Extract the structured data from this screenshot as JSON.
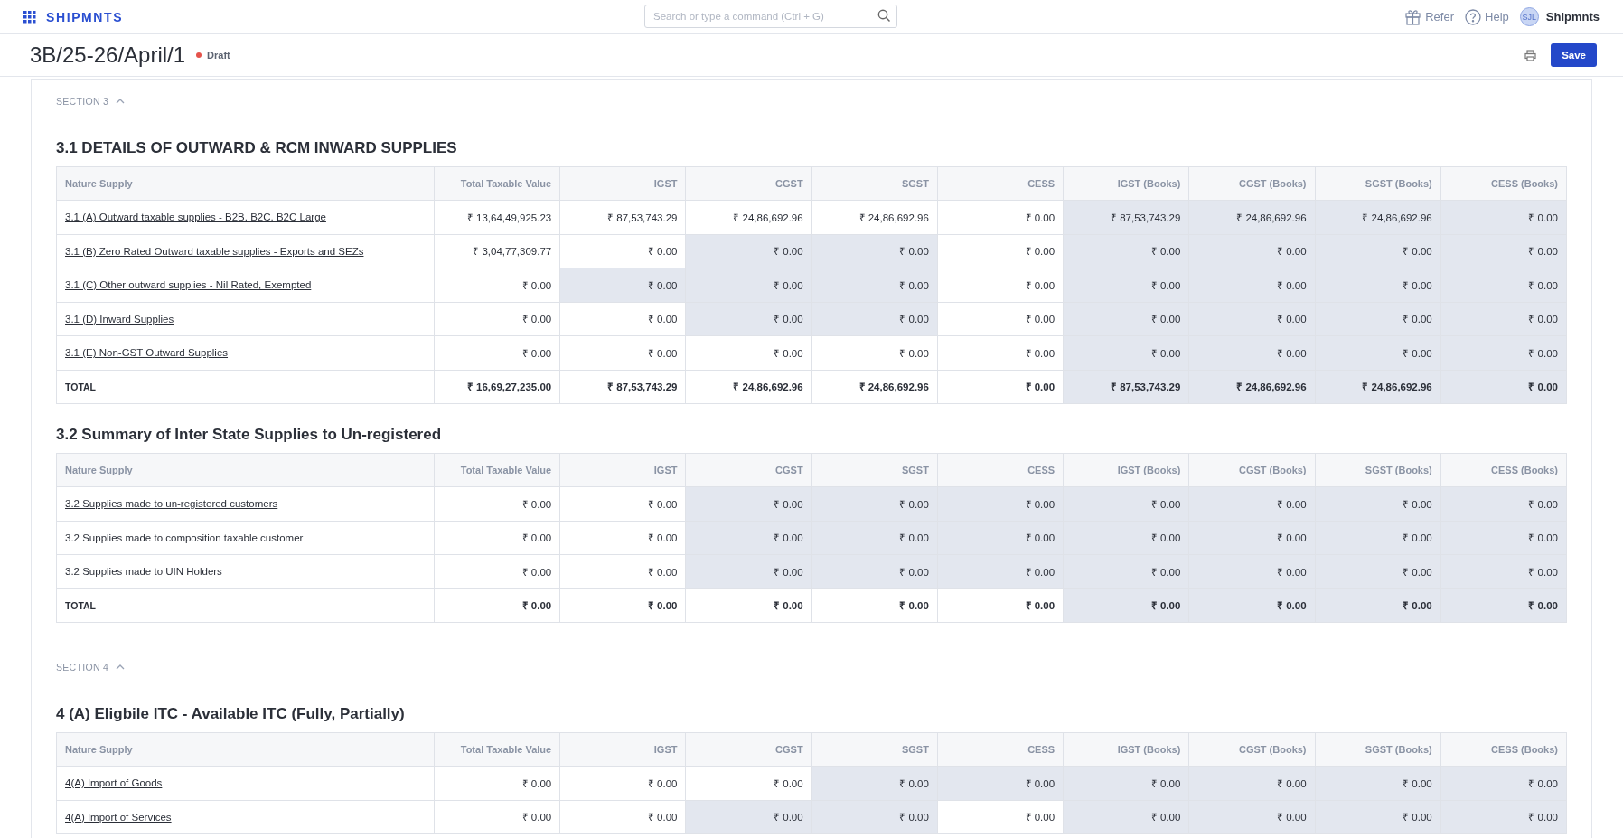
{
  "topbar": {
    "brand": "SHIPMNTS",
    "search": {
      "placeholder": "Search or type a command (Ctrl + G)"
    },
    "refer": "Refer",
    "help": "Help",
    "avatar": "SJL",
    "user": "Shipmnts"
  },
  "header": {
    "title": "3B/25-26/April/1",
    "status": "Draft",
    "save": "Save"
  },
  "sections": [
    {
      "label": "SECTION 3",
      "expanded": true,
      "tables": [
        {
          "title": "3.1 DETAILS OF OUTWARD & RCM INWARD SUPPLIES",
          "columns": [
            "Nature Supply",
            "Total Taxable Value",
            "IGST",
            "CGST",
            "SGST",
            "CESS",
            "IGST (Books)",
            "CGST (Books)",
            "SGST (Books)",
            "CESS (Books)"
          ],
          "rows": [
            {
              "kind": "link",
              "cells": [
                "3.1 (A) Outward taxable supplies - B2B, B2C, B2C Large",
                "₹ 13,64,49,925.23",
                "₹ 87,53,743.29",
                "₹ 24,86,692.96",
                "₹ 24,86,692.96",
                "₹ 0.00",
                "₹ 87,53,743.29",
                "₹ 24,86,692.96",
                "₹ 24,86,692.96",
                "₹ 0.00"
              ],
              "shaded": [
                false,
                false,
                false,
                false,
                false,
                false,
                true,
                true,
                true,
                true
              ]
            },
            {
              "kind": "link",
              "cells": [
                "3.1 (B) Zero Rated Outward taxable supplies - Exports and SEZs",
                "₹ 3,04,77,309.77",
                "₹ 0.00",
                "₹ 0.00",
                "₹ 0.00",
                "₹ 0.00",
                "₹ 0.00",
                "₹ 0.00",
                "₹ 0.00",
                "₹ 0.00"
              ],
              "shaded": [
                false,
                false,
                false,
                true,
                true,
                false,
                true,
                true,
                true,
                true
              ]
            },
            {
              "kind": "link",
              "cells": [
                "3.1 (C) Other outward supplies - Nil Rated, Exempted",
                "₹ 0.00",
                "₹ 0.00",
                "₹ 0.00",
                "₹ 0.00",
                "₹ 0.00",
                "₹ 0.00",
                "₹ 0.00",
                "₹ 0.00",
                "₹ 0.00"
              ],
              "shaded": [
                false,
                false,
                true,
                true,
                true,
                false,
                true,
                true,
                true,
                true
              ]
            },
            {
              "kind": "link",
              "cells": [
                "3.1 (D) Inward Supplies",
                "₹ 0.00",
                "₹ 0.00",
                "₹ 0.00",
                "₹ 0.00",
                "₹ 0.00",
                "₹ 0.00",
                "₹ 0.00",
                "₹ 0.00",
                "₹ 0.00"
              ],
              "shaded": [
                false,
                false,
                false,
                true,
                true,
                false,
                true,
                true,
                true,
                true
              ]
            },
            {
              "kind": "link",
              "cells": [
                "3.1 (E) Non-GST Outward Supplies",
                "₹ 0.00",
                "₹ 0.00",
                "₹ 0.00",
                "₹ 0.00",
                "₹ 0.00",
                "₹ 0.00",
                "₹ 0.00",
                "₹ 0.00",
                "₹ 0.00"
              ],
              "shaded": [
                false,
                false,
                false,
                false,
                false,
                false,
                true,
                true,
                true,
                true
              ]
            },
            {
              "kind": "total",
              "cells": [
                "TOTAL",
                "₹ 16,69,27,235.00",
                "₹ 87,53,743.29",
                "₹ 24,86,692.96",
                "₹ 24,86,692.96",
                "₹ 0.00",
                "₹ 87,53,743.29",
                "₹ 24,86,692.96",
                "₹ 24,86,692.96",
                "₹ 0.00"
              ],
              "shaded": [
                false,
                false,
                false,
                false,
                false,
                false,
                true,
                true,
                true,
                true
              ]
            }
          ]
        },
        {
          "title": "3.2 Summary of Inter State Supplies to Un-registered",
          "columns": [
            "Nature Supply",
            "Total Taxable Value",
            "IGST",
            "CGST",
            "SGST",
            "CESS",
            "IGST (Books)",
            "CGST (Books)",
            "SGST (Books)",
            "CESS (Books)"
          ],
          "rows": [
            {
              "kind": "link",
              "cells": [
                "3.2 Supplies made to un-registered customers",
                "₹ 0.00",
                "₹ 0.00",
                "₹ 0.00",
                "₹ 0.00",
                "₹ 0.00",
                "₹ 0.00",
                "₹ 0.00",
                "₹ 0.00",
                "₹ 0.00"
              ],
              "shaded": [
                false,
                false,
                false,
                true,
                true,
                true,
                true,
                true,
                true,
                true
              ]
            },
            {
              "kind": "plain",
              "cells": [
                "3.2 Supplies made to composition taxable customer",
                "₹ 0.00",
                "₹ 0.00",
                "₹ 0.00",
                "₹ 0.00",
                "₹ 0.00",
                "₹ 0.00",
                "₹ 0.00",
                "₹ 0.00",
                "₹ 0.00"
              ],
              "shaded": [
                false,
                false,
                false,
                true,
                true,
                true,
                true,
                true,
                true,
                true
              ]
            },
            {
              "kind": "plain",
              "cells": [
                "3.2 Supplies made to UIN Holders",
                "₹ 0.00",
                "₹ 0.00",
                "₹ 0.00",
                "₹ 0.00",
                "₹ 0.00",
                "₹ 0.00",
                "₹ 0.00",
                "₹ 0.00",
                "₹ 0.00"
              ],
              "shaded": [
                false,
                false,
                false,
                true,
                true,
                true,
                true,
                true,
                true,
                true
              ]
            },
            {
              "kind": "total",
              "cells": [
                "TOTAL",
                "₹ 0.00",
                "₹ 0.00",
                "₹ 0.00",
                "₹ 0.00",
                "₹ 0.00",
                "₹ 0.00",
                "₹ 0.00",
                "₹ 0.00",
                "₹ 0.00"
              ],
              "shaded": [
                false,
                false,
                false,
                false,
                false,
                false,
                true,
                true,
                true,
                true
              ]
            }
          ]
        }
      ]
    },
    {
      "label": "SECTION 4",
      "expanded": true,
      "tables": [
        {
          "title": "4 (A) Eligbile ITC - Available ITC (Fully, Partially)",
          "columns": [
            "Nature Supply",
            "Total Taxable Value",
            "IGST",
            "CGST",
            "SGST",
            "CESS",
            "IGST (Books)",
            "CGST (Books)",
            "SGST (Books)",
            "CESS (Books)"
          ],
          "rows": [
            {
              "kind": "link",
              "cells": [
                "4(A) Import of Goods",
                "₹ 0.00",
                "₹ 0.00",
                "₹ 0.00",
                "₹ 0.00",
                "₹ 0.00",
                "₹ 0.00",
                "₹ 0.00",
                "₹ 0.00",
                "₹ 0.00"
              ],
              "shaded": [
                false,
                false,
                false,
                false,
                true,
                true,
                true,
                true,
                true,
                true
              ]
            },
            {
              "kind": "link",
              "cells": [
                "4(A) Import of Services",
                "₹ 0.00",
                "₹ 0.00",
                "₹ 0.00",
                "₹ 0.00",
                "₹ 0.00",
                "₹ 0.00",
                "₹ 0.00",
                "₹ 0.00",
                "₹ 0.00"
              ],
              "shaded": [
                false,
                false,
                false,
                true,
                true,
                false,
                true,
                true,
                true,
                true
              ]
            }
          ]
        }
      ]
    }
  ]
}
